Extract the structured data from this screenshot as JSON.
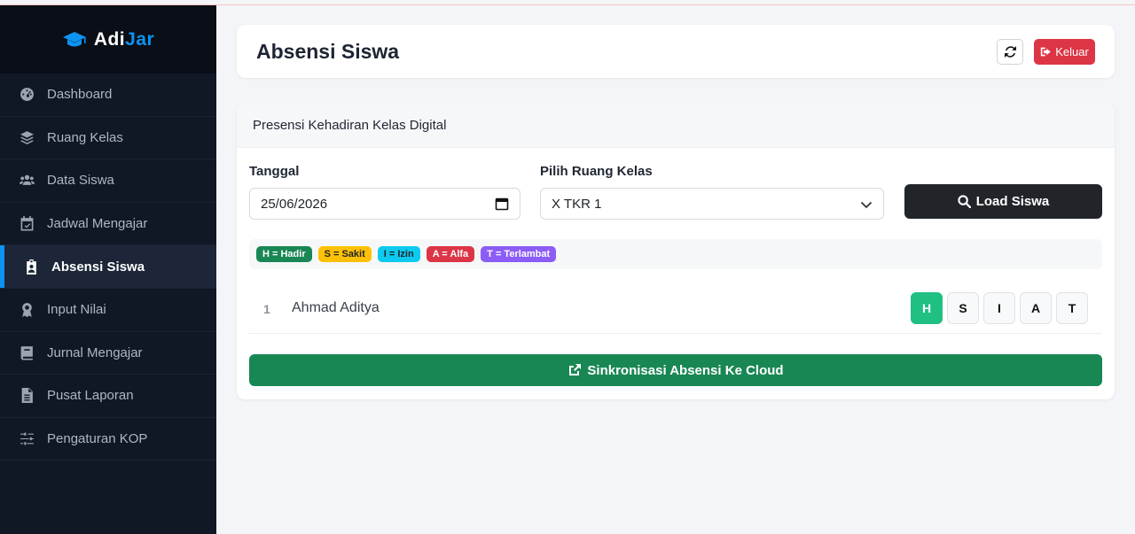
{
  "brand": {
    "name_part1": "Adi",
    "name_part2": "Jar",
    "icon": "graduation-cap-icon"
  },
  "sidebar": {
    "items": [
      {
        "label": "Dashboard",
        "icon": "gauge-icon",
        "active": false
      },
      {
        "label": "Ruang Kelas",
        "icon": "layers-icon",
        "active": false
      },
      {
        "label": "Data Siswa",
        "icon": "users-icon",
        "active": false
      },
      {
        "label": "Jadwal Mengajar",
        "icon": "calendar-check-icon",
        "active": false
      },
      {
        "label": "Absensi Siswa",
        "icon": "clipboard-user-icon",
        "active": true
      },
      {
        "label": "Input Nilai",
        "icon": "award-icon",
        "active": false
      },
      {
        "label": "Jurnal Mengajar",
        "icon": "book-icon",
        "active": false
      },
      {
        "label": "Pusat Laporan",
        "icon": "file-lines-icon",
        "active": false
      },
      {
        "label": "Pengaturan KOP",
        "icon": "sliders-icon",
        "active": false
      }
    ]
  },
  "header": {
    "title": "Absensi Siswa",
    "refresh_icon": "refresh-icon",
    "logout_label": "Keluar"
  },
  "card": {
    "heading": "Presensi Kehadiran Kelas Digital",
    "date_label": "Tanggal",
    "date_value": "25/06/2026",
    "class_label": "Pilih Ruang Kelas",
    "class_value": "X TKR 1",
    "load_label": "Load Siswa"
  },
  "legend": [
    {
      "label": "H = Hadir",
      "color": "#198754",
      "text_color": "#ffffff"
    },
    {
      "label": "S = Sakit",
      "color": "#ffc107",
      "text_color": "#212529"
    },
    {
      "label": "I = Izin",
      "color": "#0dcaf0",
      "text_color": "#212529"
    },
    {
      "label": "A = Alfa",
      "color": "#dc3545",
      "text_color": "#ffffff"
    },
    {
      "label": "T = Terlambat",
      "color": "#8b5cf6",
      "text_color": "#ffffff"
    }
  ],
  "students": [
    {
      "number": "1",
      "name": "Ahmad Aditya",
      "options": [
        "H",
        "S",
        "I",
        "A",
        "T"
      ],
      "selected": "H"
    }
  ],
  "sync_label": "Sinkronisasi Absensi Ke Cloud"
}
